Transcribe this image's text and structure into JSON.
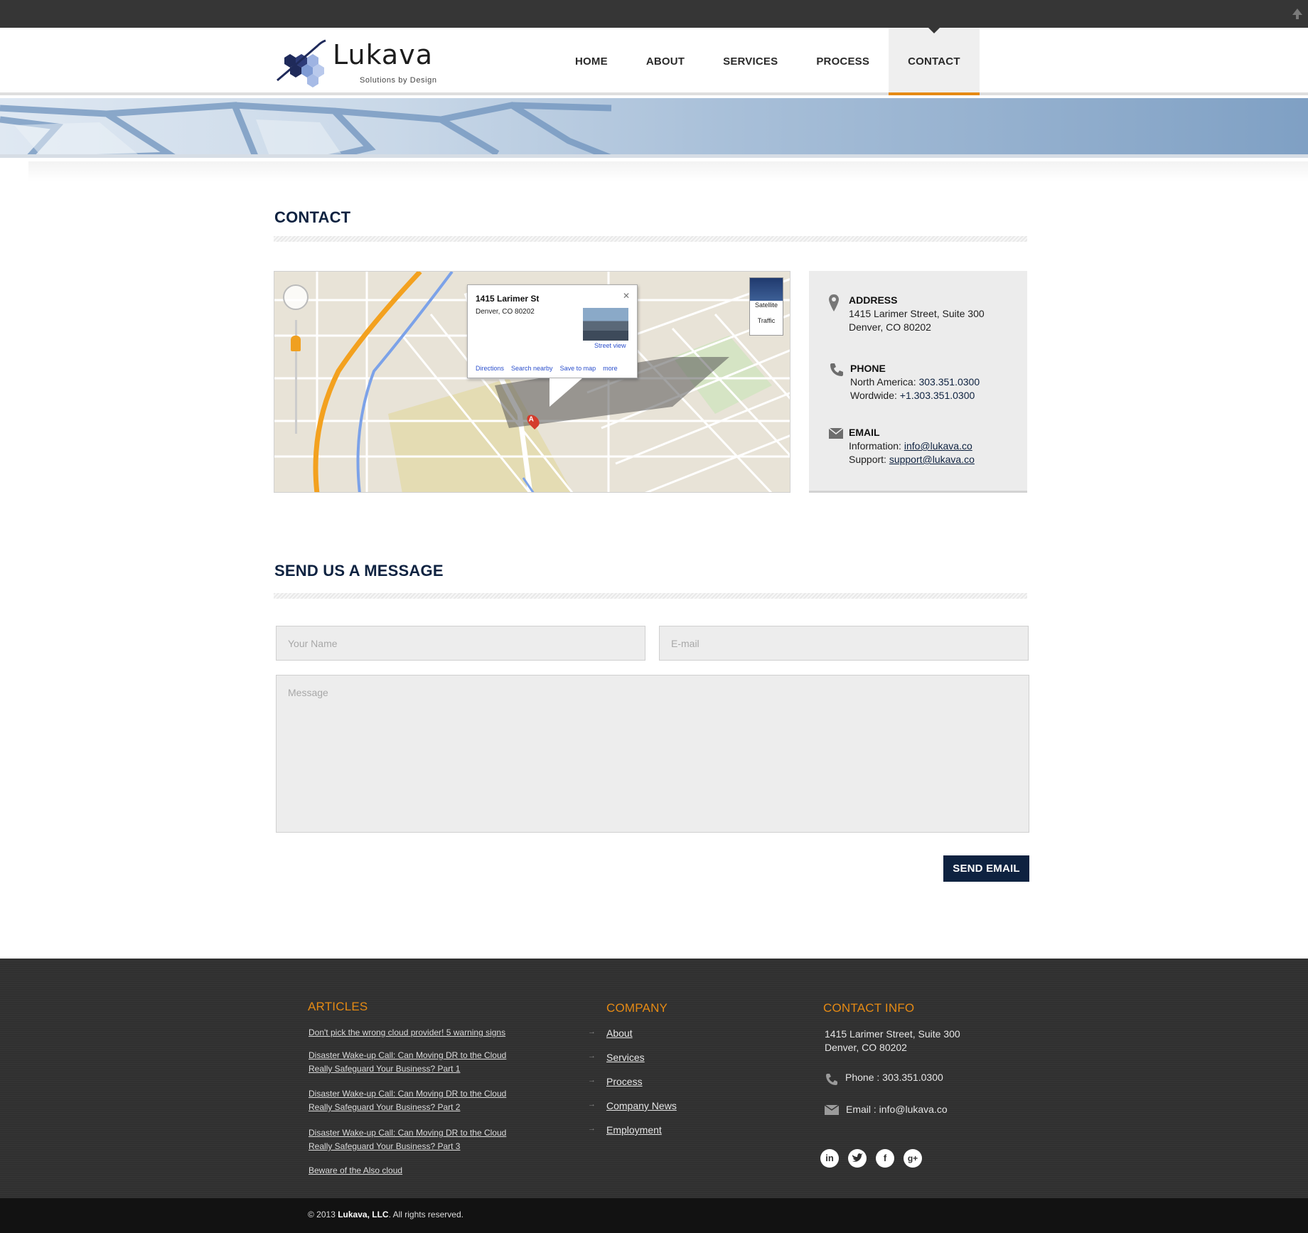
{
  "brand": {
    "name": "Lukava",
    "tagline": "Solutions by Design",
    "accent": "#e58a14",
    "navy": "#0e2240"
  },
  "nav": {
    "items": [
      "HOME",
      "ABOUT",
      "SERVICES",
      "PROCESS",
      "CONTACT"
    ],
    "active": "CONTACT"
  },
  "contact": {
    "heading": "CONTACT",
    "map": {
      "popup_title": "1415 Larimer St",
      "popup_address": "Denver, CO 80202",
      "street_view": "Street view",
      "links": [
        "Directions",
        "Search nearby",
        "Save to map",
        "more"
      ],
      "map_types": [
        "Satellite",
        "Traffic"
      ],
      "marker": "A"
    },
    "address_label": "ADDRESS",
    "address_line1": "1415 Larimer Street, Suite 300",
    "address_line2": "Denver, CO 80202",
    "phone_label": "PHONE",
    "phone_na_label": "North America:",
    "phone_na": "303.351.0300",
    "phone_ww_label": "Wordwide:",
    "phone_ww": "+1.303.351.0300",
    "email_label": "EMAIL",
    "email_info_label": "Information:",
    "email_info": "info@lukava.co",
    "email_support_label": "Support:",
    "email_support": "support@lukava.co"
  },
  "form": {
    "heading": "SEND US A MESSAGE",
    "name_placeholder": "Your Name",
    "email_placeholder": "E-mail",
    "message_placeholder": "Message",
    "submit": "SEND EMAIL"
  },
  "footer": {
    "articles_heading": "ARTICLES",
    "articles": [
      "Don't pick the wrong cloud provider! 5 warning signs",
      "Disaster Wake-up Call: Can Moving DR to the Cloud Really Safeguard Your Business? Part 1",
      "Disaster Wake-up Call: Can Moving DR to the Cloud Really Safeguard Your Business? Part 2",
      "Disaster Wake-up Call: Can Moving DR to the Cloud Really Safeguard Your Business? Part 3",
      "Beware of the Also cloud"
    ],
    "company_heading": "COMPANY",
    "company_links": [
      "About",
      "Services",
      "Process",
      "Company News",
      "Employment"
    ],
    "contact_heading": "CONTACT INFO",
    "contact_address1": "1415 Larimer Street, Suite 300",
    "contact_address2": "Denver, CO 80202",
    "contact_phone": "Phone : 303.351.0300",
    "contact_email": "Email : info@lukava.co",
    "social": [
      "linkedin-icon",
      "twitter-icon",
      "facebook-icon",
      "google-plus-icon"
    ],
    "copyright_prefix": "© 2013",
    "copyright_company": "Lukava, LLC",
    "copyright_suffix": ". All rights reserved."
  }
}
